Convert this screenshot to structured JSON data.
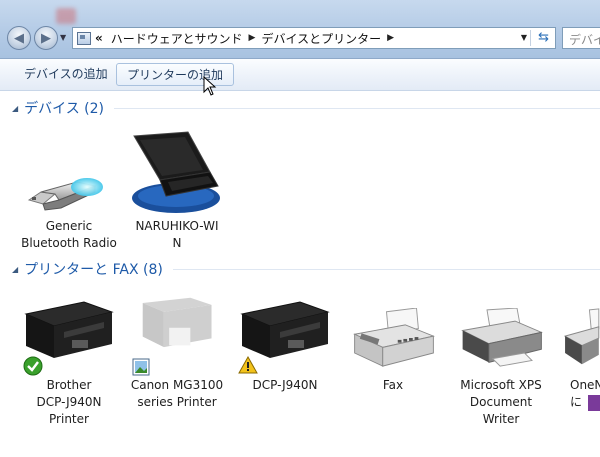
{
  "address_bar": {
    "overflow_glyph": "«",
    "breadcrumbs": [
      "ハードウェアとサウンド",
      "デバイスとプリンター"
    ],
    "search_placeholder": "デバイ"
  },
  "command_bar": {
    "add_device": "デバイスの追加",
    "add_printer": "プリンターの追加"
  },
  "groups": {
    "devices": {
      "header": "デバイス (2)",
      "items": [
        {
          "label": "Generic\nBluetooth Radio",
          "icon": "usb-bluetooth-icon"
        },
        {
          "label": "NARUHIKO-WI\nN",
          "icon": "laptop-icon"
        }
      ]
    },
    "printers": {
      "header": "プリンターと FAX (8)",
      "items": [
        {
          "label": "Brother\nDCP-J940N\nPrinter",
          "icon": "printer-icon",
          "badge": "default-check-icon"
        },
        {
          "label": "Canon MG3100\nseries Printer",
          "icon": "printer-icon",
          "badge": "photo-icon"
        },
        {
          "label": "DCP-J940N",
          "icon": "printer-icon",
          "badge": "warning-icon"
        },
        {
          "label": "Fax",
          "icon": "fax-icon"
        },
        {
          "label": "Microsoft XPS\nDocument\nWriter",
          "icon": "printer-icon"
        },
        {
          "label": "OneN\nに",
          "icon": "printer-icon"
        }
      ]
    }
  },
  "colors": {
    "group_header": "#1e5aa8",
    "addr_bar": "#b4cbe6",
    "check_badge": "#3aa02c",
    "warning_badge": "#f2c21b"
  }
}
